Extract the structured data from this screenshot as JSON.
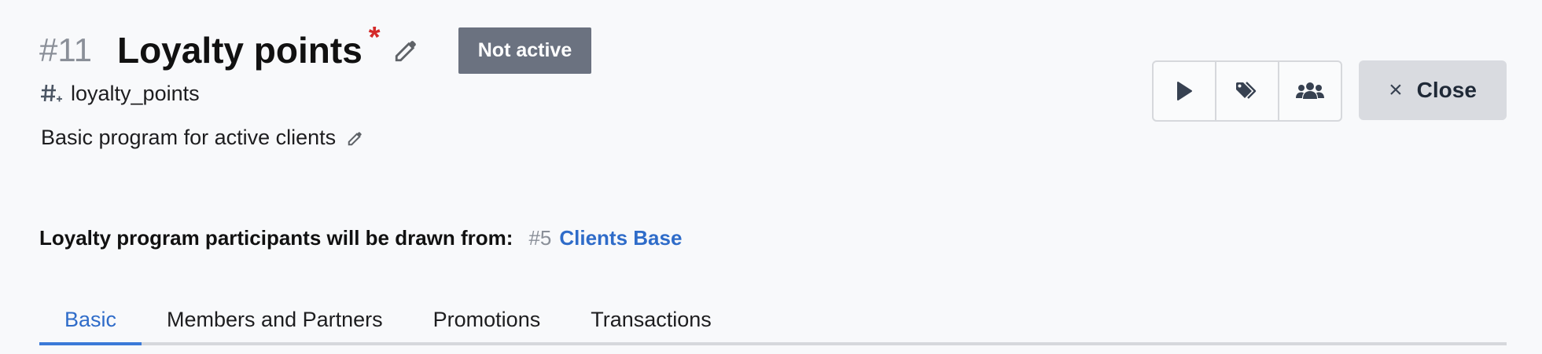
{
  "header": {
    "record_id": "#11",
    "title": "Loyalty points",
    "required_marker": "*",
    "status": "Not active"
  },
  "code": {
    "value": "loyalty_points"
  },
  "description": {
    "text": "Basic program for active clients"
  },
  "actions": {
    "buttons": [
      {
        "icon": "play-icon"
      },
      {
        "icon": "tags-icon"
      },
      {
        "icon": "users-icon"
      }
    ],
    "close_label": "Close",
    "close_icon": "×"
  },
  "source": {
    "label": "Loyalty program participants will be drawn from:",
    "id": "#5",
    "name": "Clients Base"
  },
  "tabs": [
    {
      "label": "Basic",
      "active": true
    },
    {
      "label": "Members and Partners",
      "active": false
    },
    {
      "label": "Promotions",
      "active": false
    },
    {
      "label": "Transactions",
      "active": false
    }
  ],
  "colors": {
    "accent": "#2f6cc9",
    "status_badge": "#6b7280",
    "required": "#d42a2a"
  }
}
